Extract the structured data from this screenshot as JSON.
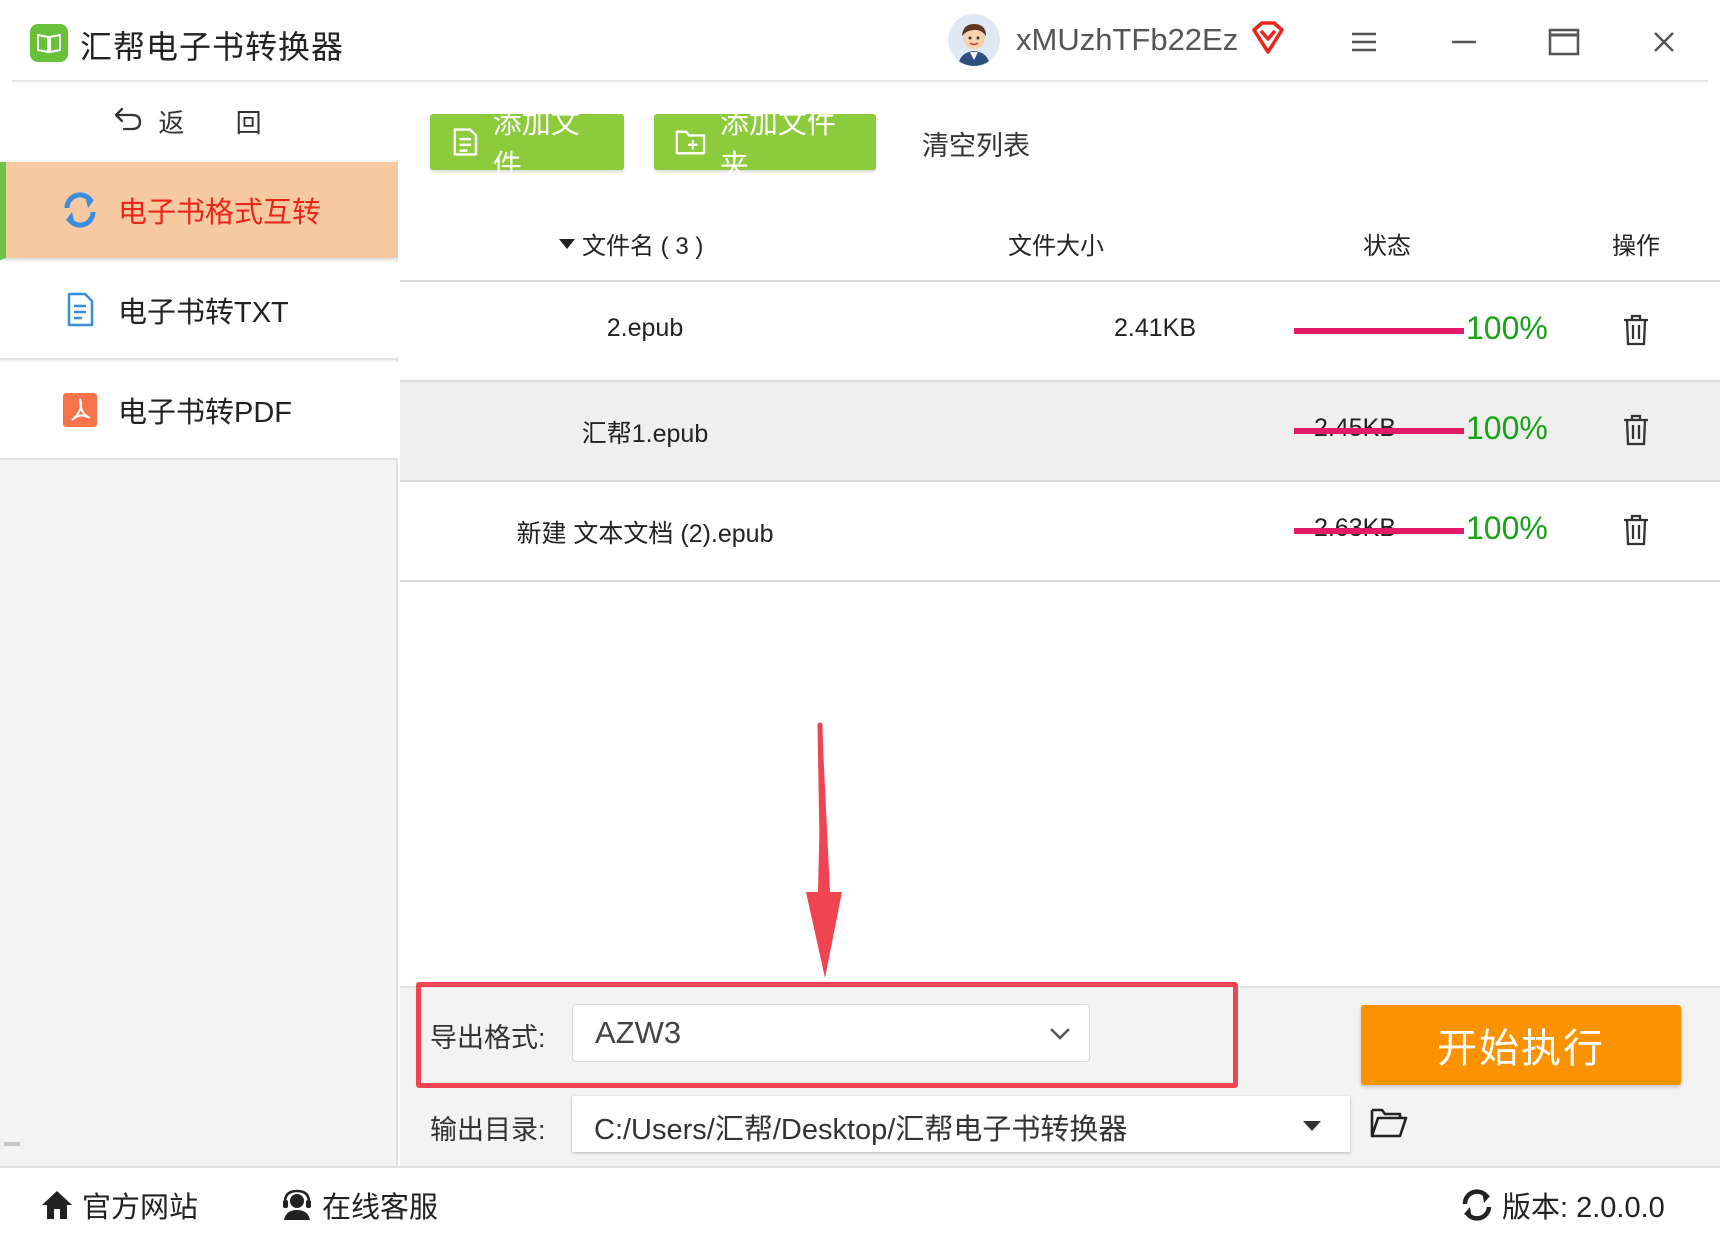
{
  "app": {
    "title": "汇帮电子书转换器",
    "username": "xMUzhTFb22Ez"
  },
  "sidebar": {
    "back_label": "返 回",
    "items": [
      {
        "label": "电子书格式互转",
        "icon": "refresh-icon",
        "active": true
      },
      {
        "label": "电子书转TXT",
        "icon": "document-icon",
        "active": false
      },
      {
        "label": "电子书转PDF",
        "icon": "pdf-icon",
        "active": false
      }
    ]
  },
  "toolbar": {
    "add_file_label": "添加文件",
    "add_folder_label": "添加文件夹",
    "clear_label": "清空列表"
  },
  "table": {
    "headers": {
      "name": "文件名 ( 3 )",
      "size": "文件大小",
      "status": "状态",
      "action": "操作"
    },
    "rows": [
      {
        "name": "2.epub",
        "size": "2.41KB",
        "progress": 1.0,
        "percent": "100%"
      },
      {
        "name": "汇帮1.epub",
        "size": "2.45KB",
        "progress": 1.0,
        "percent": "100%"
      },
      {
        "name": "新建 文本文档 (2).epub",
        "size": "2.63KB",
        "progress": 1.0,
        "percent": "100%"
      }
    ]
  },
  "settings": {
    "format_label": "导出格式:",
    "format_value": "AZW3",
    "outdir_label": "输出目录:",
    "outdir_value": "C:/Users/汇帮/Desktop/汇帮电子书转换器",
    "start_label": "开始执行"
  },
  "footer": {
    "website_label": "官方网站",
    "support_label": "在线客服",
    "version_label": "版本: 2.0.0.0"
  },
  "colors": {
    "accent_green": "#8ccc3c",
    "active_nav_bg": "#f7c9a1",
    "active_nav_text": "#e8261b",
    "progress_bar": "#e31b64",
    "percent_text": "#16a316",
    "start_button": "#fb9200",
    "annotation_red": "#ef4452"
  }
}
